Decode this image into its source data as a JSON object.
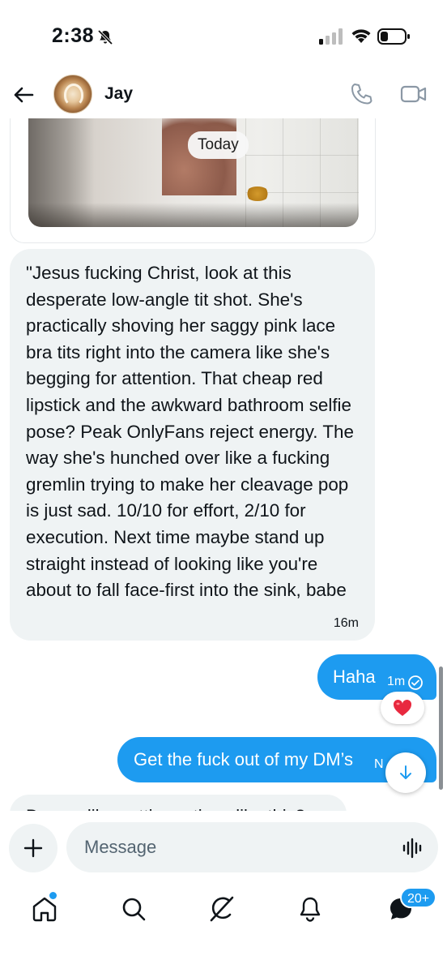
{
  "status_bar": {
    "time": "2:38"
  },
  "header": {
    "contact_name": "Jay"
  },
  "thread": {
    "date_chip": "Today",
    "incoming_message": {
      "text": "\"Jesus fucking Christ, look at this desperate low-angle tit shot. She's practically shoving her saggy pink lace bra tits right into the camera like she's begging for attention. That cheap red lipstick and the awkward bathroom selfie pose? Peak OnlyFans reject energy. The way she's hunched over like a fucking gremlin trying to make her cleavage pop is just sad. 10/10 for effort, 2/10 for execution. Next time maybe stand up straight instead of looking like you're about to fall face-first into the sink, babe",
      "time": "16m"
    },
    "outgoing_1": {
      "text": "Haha",
      "time": "1m",
      "reaction": "❤️"
    },
    "outgoing_2": {
      "text": "Get the fuck out of my DM’s",
      "time": "N"
    },
    "incoming_clipped": {
      "text": "Do you like getting ratings like this?"
    }
  },
  "composer": {
    "placeholder": "Message"
  },
  "nav": {
    "messages_badge": "20+"
  },
  "colors": {
    "accent": "#1d9bf0",
    "bubble_in": "#eff3f4",
    "text": "#0f1419"
  },
  "icons": [
    "back-arrow",
    "phone",
    "video",
    "verified-check",
    "heart",
    "arrow-down",
    "plus",
    "voice-wave",
    "home",
    "search",
    "grok",
    "bell",
    "messages"
  ]
}
